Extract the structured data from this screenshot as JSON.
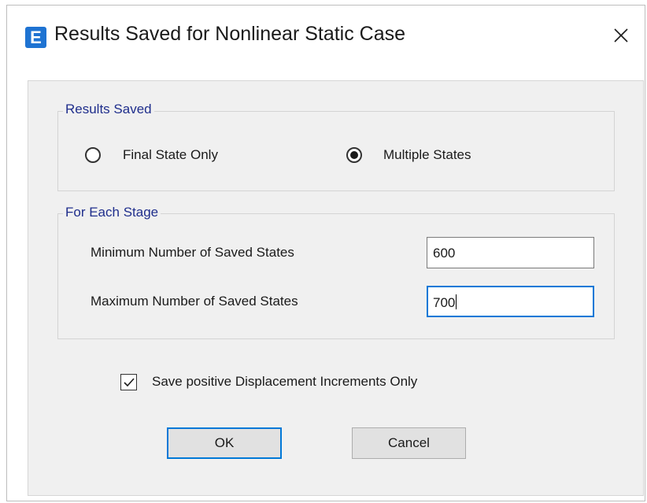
{
  "window": {
    "app_icon_letter": "E",
    "title": "Results Saved for Nonlinear Static Case",
    "close_glyph": "×"
  },
  "results_saved": {
    "group_label": "Results Saved",
    "options": [
      {
        "label": "Final State Only",
        "selected": false
      },
      {
        "label": "Multiple States",
        "selected": true
      }
    ]
  },
  "for_each_stage": {
    "group_label": "For Each Stage",
    "min_label": "Minimum Number of Saved States",
    "min_value": "600",
    "max_label": "Maximum Number of Saved States",
    "max_value": "700"
  },
  "options": {
    "save_positive_label": "Save positive Displacement Increments Only",
    "save_positive_checked": true
  },
  "buttons": {
    "ok": "OK",
    "cancel": "Cancel"
  },
  "colors": {
    "accent": "#0078d7",
    "group_label": "#1f2e8c",
    "app_icon": "#1e73d2",
    "client_bg": "#f0f0f0"
  }
}
